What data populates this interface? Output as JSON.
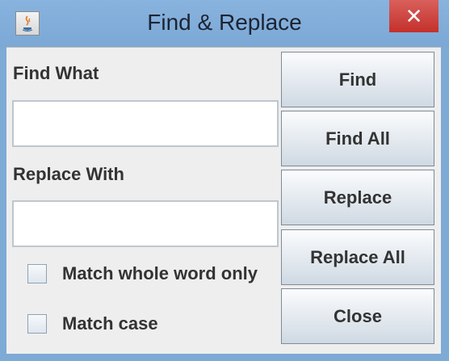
{
  "window": {
    "title": "Find & Replace",
    "close_glyph": "✕",
    "app_icon": "java-coffee-cup-icon"
  },
  "form": {
    "find_label": "Find What",
    "find_value": "",
    "replace_label": "Replace With",
    "replace_value": "",
    "options": [
      {
        "label": "Match whole word only",
        "checked": false
      },
      {
        "label": "Match case",
        "checked": false
      }
    ]
  },
  "buttons": {
    "find": "Find",
    "find_all": "Find All",
    "replace": "Replace",
    "replace_all": "Replace All",
    "close": "Close"
  },
  "colors": {
    "titlebar": "#7eaad6",
    "close_button": "#c4302b",
    "panel": "#eeeeee"
  }
}
